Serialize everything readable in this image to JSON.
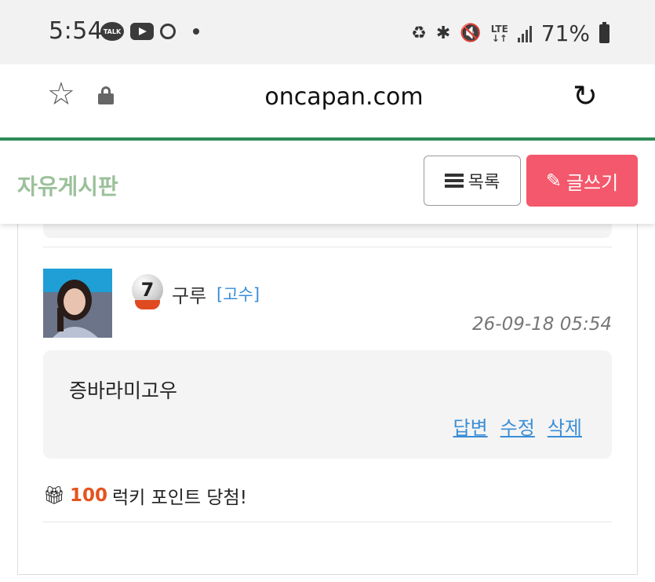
{
  "status_bar": {
    "time": "5:54",
    "talk_label": "TALK",
    "network": "LTE",
    "battery": "71%"
  },
  "browser": {
    "url": "oncapan.com"
  },
  "board": {
    "title": "자유게시판",
    "list_button": "목록",
    "write_button": "글쓰기"
  },
  "comment": {
    "level": "7",
    "username": "구루",
    "rank": "[고수]",
    "date": "26-09-18 05:54",
    "text": "증바라미고우",
    "actions": {
      "reply": "답변",
      "edit": "수정",
      "delete": "삭제"
    },
    "lucky_points": "100",
    "lucky_text": "럭키 포인트 당첨!"
  },
  "colors": {
    "accent_green": "#2e8b57",
    "title_green": "#9bc09b",
    "write_button": "#f4586c",
    "link_blue": "#3a8ed6",
    "lucky_orange": "#e5531e"
  }
}
